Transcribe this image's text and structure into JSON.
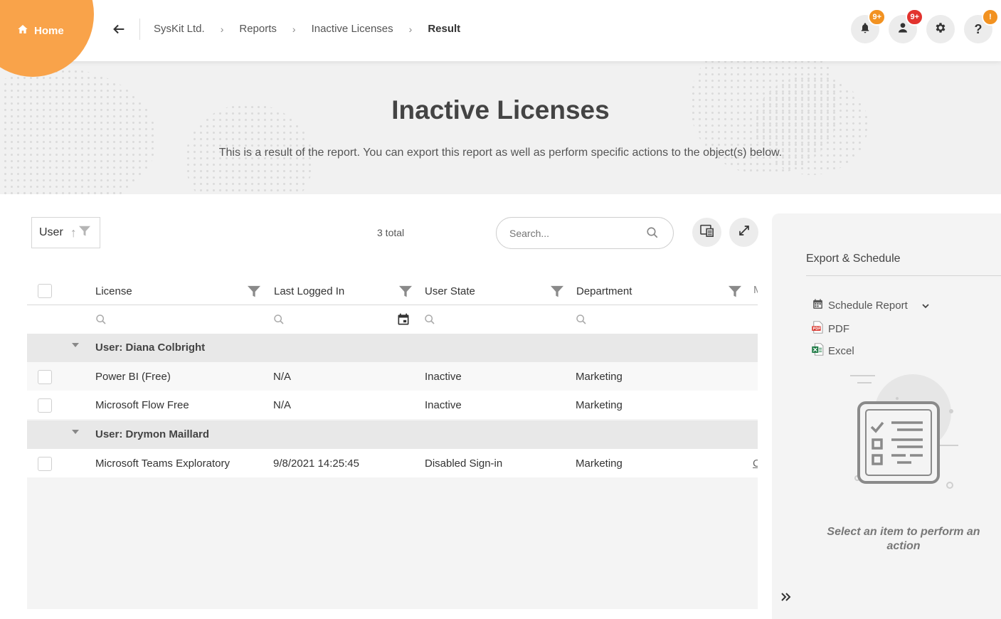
{
  "topbar": {
    "home_label": "Home",
    "breadcrumb": [
      "SysKit Ltd.",
      "Reports",
      "Inactive Licenses"
    ],
    "breadcrumb_current": "Result",
    "notifications_badge": "9+",
    "users_badge": "9+",
    "help_badge": "!"
  },
  "hero": {
    "title": "Inactive Licenses",
    "subtitle": "This is a result of the report. You can export this report as well as perform specific actions to the object(s) below."
  },
  "toolbar": {
    "group_by": "User",
    "total": "3 total",
    "search_placeholder": "Search..."
  },
  "grid": {
    "columns": [
      "License",
      "Last Logged In",
      "User State",
      "Department"
    ],
    "groups": [
      {
        "label": "User: Diana Colbright",
        "rows": [
          {
            "license": "Power BI (Free)",
            "last_logged_in": "N/A",
            "user_state": "Inactive",
            "department": "Marketing"
          },
          {
            "license": "Microsoft Flow Free",
            "last_logged_in": "N/A",
            "user_state": "Inactive",
            "department": "Marketing"
          }
        ]
      },
      {
        "label": "User: Drymon Maillard",
        "rows": [
          {
            "license": "Microsoft Teams Exploratory",
            "last_logged_in": "9/8/2021 14:25:45",
            "user_state": "Disabled Sign-in",
            "department": "Marketing"
          }
        ]
      }
    ]
  },
  "panel": {
    "title": "Export & Schedule",
    "schedule_label": "Schedule Report",
    "pdf_label": "PDF",
    "excel_label": "Excel",
    "empty_message": "Select an item to perform an action"
  },
  "colors": {
    "accent": "#f9a34a",
    "badge_orange": "#f29221",
    "badge_red": "#e2332e"
  }
}
